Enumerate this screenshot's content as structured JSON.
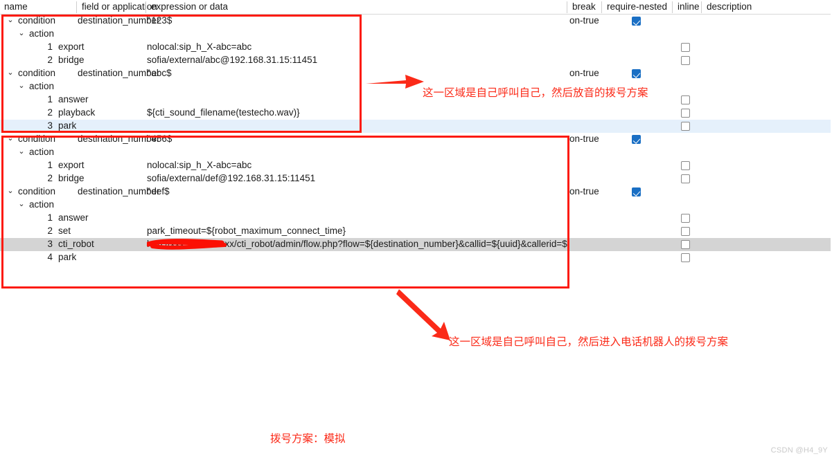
{
  "header": {
    "columns": [
      {
        "label": "name",
        "key": "name"
      },
      {
        "label": "field or application",
        "key": "field"
      },
      {
        "label": "expression or data",
        "key": "expr"
      },
      {
        "label": "break",
        "key": "break"
      },
      {
        "label": "require-nested",
        "key": "require_nested"
      },
      {
        "label": "inline",
        "key": "inline"
      },
      {
        "label": "description",
        "key": "description"
      }
    ]
  },
  "rows": [
    {
      "type": "condition",
      "chevron": "v",
      "name": "condition",
      "field": "destination_number",
      "expr": "^123$",
      "break": "on-true",
      "require_nested": "checked",
      "inline": null,
      "highlight": null
    },
    {
      "type": "action-group",
      "chevron": "v",
      "name": "action",
      "field": "",
      "expr": "",
      "break": "",
      "require_nested": null,
      "inline": null,
      "highlight": null
    },
    {
      "type": "action",
      "index": "1",
      "name": "export",
      "field": "",
      "expr": "nolocal:sip_h_X-abc=abc",
      "break": "",
      "require_nested": null,
      "inline": "unchecked",
      "highlight": null
    },
    {
      "type": "action",
      "index": "2",
      "name": "bridge",
      "field": "",
      "expr": "sofia/external/abc@192.168.31.15:11451",
      "break": "",
      "require_nested": null,
      "inline": "unchecked",
      "highlight": null
    },
    {
      "type": "condition",
      "chevron": "v",
      "name": "condition",
      "field": "destination_number",
      "expr": "^abc$",
      "break": "on-true",
      "require_nested": "checked",
      "inline": null,
      "highlight": null
    },
    {
      "type": "action-group",
      "chevron": "v",
      "name": "action",
      "field": "",
      "expr": "",
      "break": "",
      "require_nested": null,
      "inline": null,
      "highlight": null
    },
    {
      "type": "action",
      "index": "1",
      "name": "answer",
      "field": "",
      "expr": "",
      "break": "",
      "require_nested": null,
      "inline": "unchecked",
      "highlight": null
    },
    {
      "type": "action",
      "index": "2",
      "name": "playback",
      "field": "",
      "expr": "${cti_sound_filename(testecho.wav)}",
      "break": "",
      "require_nested": null,
      "inline": "unchecked",
      "highlight": null
    },
    {
      "type": "action",
      "index": "3",
      "name": "park",
      "field": "",
      "expr": "",
      "break": "",
      "require_nested": null,
      "inline": "unchecked",
      "highlight": "blue"
    },
    {
      "type": "condition",
      "chevron": "v",
      "name": "condition",
      "field": "destination_number",
      "expr": "^456$",
      "break": "on-true",
      "require_nested": "checked",
      "inline": null,
      "highlight": null
    },
    {
      "type": "action-group",
      "chevron": "v",
      "name": "action",
      "field": "",
      "expr": "",
      "break": "",
      "require_nested": null,
      "inline": null,
      "highlight": null
    },
    {
      "type": "action",
      "index": "1",
      "name": "export",
      "field": "",
      "expr": "nolocal:sip_h_X-abc=abc",
      "break": "",
      "require_nested": null,
      "inline": "unchecked",
      "highlight": null
    },
    {
      "type": "action",
      "index": "2",
      "name": "bridge",
      "field": "",
      "expr": "sofia/external/def@192.168.31.15:11451",
      "break": "",
      "require_nested": null,
      "inline": "unchecked",
      "highlight": null
    },
    {
      "type": "condition",
      "chevron": "v",
      "name": "condition",
      "field": "destination_number",
      "expr": "^def$",
      "break": "on-true",
      "require_nested": "checked",
      "inline": null,
      "highlight": null
    },
    {
      "type": "action-group",
      "chevron": "v",
      "name": "action",
      "field": "",
      "expr": "",
      "break": "",
      "require_nested": null,
      "inline": null,
      "highlight": null
    },
    {
      "type": "action",
      "index": "1",
      "name": "answer",
      "field": "",
      "expr": "",
      "break": "",
      "require_nested": null,
      "inline": "unchecked",
      "highlight": null
    },
    {
      "type": "action",
      "index": "2",
      "name": "set",
      "field": "",
      "expr": "park_timeout=${robot_maximum_connect_time}",
      "break": "",
      "require_nested": null,
      "inline": "unchecked",
      "highlight": null
    },
    {
      "type": "action",
      "index": "3",
      "name": "cti_robot",
      "field": "",
      "expr": "http://xxx.xxx.xxx.xxx/cti_robot/admin/flow.php?flow=${destination_number}&callid=${uuid}&callerid=${caller_id_number}",
      "expr_redacted": true,
      "break": "",
      "require_nested": null,
      "inline": "unchecked",
      "highlight": "gray"
    },
    {
      "type": "action",
      "index": "4",
      "name": "park",
      "field": "",
      "expr": "",
      "break": "",
      "require_nested": null,
      "inline": "unchecked",
      "highlight": null
    }
  ],
  "annotations": {
    "box1_label": "red-outline-box-playback-plan",
    "box2_label": "red-outline-box-robot-plan",
    "arrow1_label": "red-arrow-right",
    "arrow2_label": "red-arrow-down-right",
    "note1": "这一区域是自己呼叫自己，然后放音的拨号方案",
    "note2": "这一区域是自己呼叫自己，然后进入电话机器人的拨号方案",
    "caption": "拨号方案：模拟",
    "color": "#fb2a18"
  },
  "watermark": "CSDN @H4_9Y"
}
